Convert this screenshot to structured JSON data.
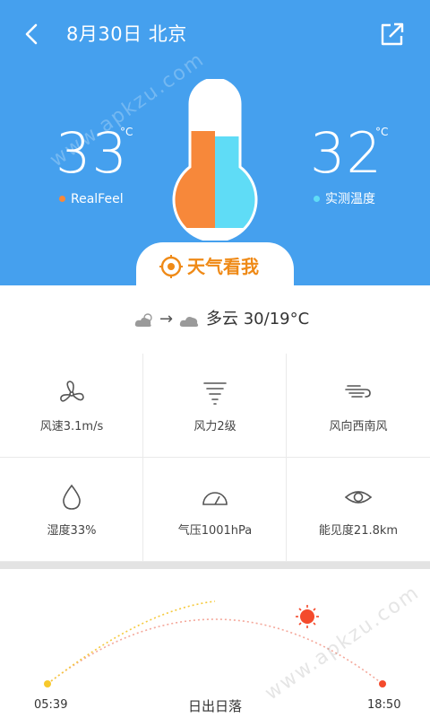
{
  "header": {
    "title": "8月30日 北京",
    "back_icon": "chevron-left-icon",
    "share_icon": "share-icon"
  },
  "temperatures": {
    "realfeel": {
      "value": "33",
      "unit": "°C",
      "label": "RealFeel",
      "color": "#f7883a"
    },
    "measured": {
      "value": "32",
      "unit": "°C",
      "label": "实测温度",
      "color": "#5fdcf6"
    }
  },
  "thermometer": {
    "left_color": "#f7883a",
    "right_color": "#5fdcf6"
  },
  "brand": {
    "name": "天气看我",
    "color": "#ef8a17"
  },
  "watermark": {
    "text": "www.apkzu.com"
  },
  "forecast": {
    "from_icon": "partly-cloudy-icon",
    "to_icon": "cloud-icon",
    "arrow": "→",
    "summary": "多云 30/19°C"
  },
  "details": [
    {
      "icon": "fan-icon",
      "label": "风速3.1m/s"
    },
    {
      "icon": "tornado-icon",
      "label": "风力2级"
    },
    {
      "icon": "wind-icon",
      "label": "风向西南风"
    },
    {
      "icon": "droplet-icon",
      "label": "湿度33%"
    },
    {
      "icon": "gauge-icon",
      "label": "气压1001hPa"
    },
    {
      "icon": "eye-icon",
      "label": "能见度21.8km"
    }
  ],
  "sun": {
    "sunrise": "05:39",
    "sunset": "18:50",
    "label": "日出日落",
    "sun_color": "#f44a2c",
    "rise_color": "#f7c92c"
  },
  "colors": {
    "accent": "#45a0ee"
  }
}
